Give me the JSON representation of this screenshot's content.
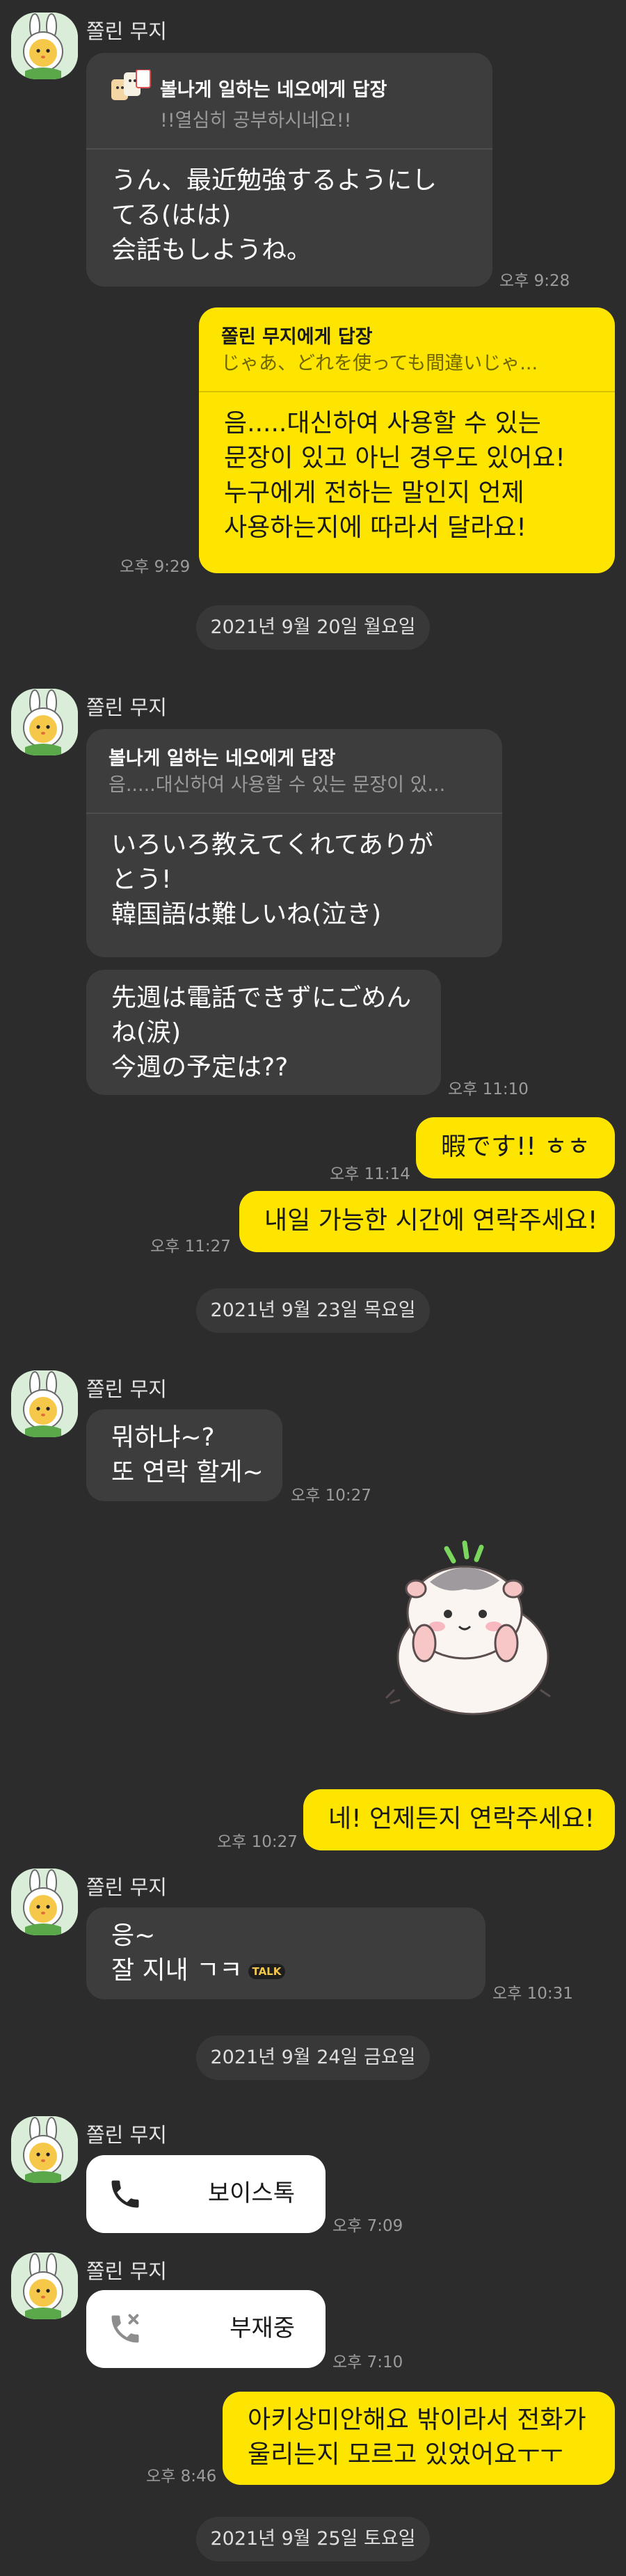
{
  "contact_name": "쫄린 무지",
  "messages": {
    "m1": {
      "reply_to": "볼나게 일하는 네오에게 답장",
      "reply_quote": "!!열심히 공부하시네요!!",
      "lines": [
        "うん、最近勉強するようにし",
        "てる(はは)",
        "会話もしようね。"
      ],
      "time": "오후 9:28"
    },
    "m2": {
      "reply_to": "쫄린 무지에게 답장",
      "reply_quote": "じゃあ、どれを使っても間違いじゃ...",
      "lines": [
        "음.....대신하여 사용할 수 있는",
        "문장이 있고 아닌 경우도 있어요!",
        "누구에게 전하는 말인지 언제",
        "사용하는지에 따라서 달라요!"
      ],
      "time": "오후 9:29"
    },
    "m3": {
      "reply_to": "볼나게 일하는 네오에게 답장",
      "reply_quote": "음.....대신하여 사용할 수 있는 문장이 있...",
      "lines": [
        "いろいろ教えてくれてありが",
        "とう!",
        "韓国語は難しいね(泣き)"
      ]
    },
    "m4": {
      "lines": [
        "先週は電話できずにごめん",
        "ね(涙)",
        "今週の予定は??"
      ],
      "time": "오후 11:10"
    },
    "m5": {
      "text": "暇です!! ㅎㅎ",
      "time": "오후 11:14"
    },
    "m6": {
      "text": "내일 가능한 시간에 연락주세요!",
      "time": "오후 11:27"
    },
    "m7": {
      "lines": [
        "뭐하냐~?",
        "또 연락 할게~"
      ],
      "time": "오후 10:27"
    },
    "m8": {
      "text": "네! 언제든지 연락주세요!",
      "time": "오후 10:27"
    },
    "m9": {
      "lines": [
        "응~",
        "잘 지내 ㄱㅋ"
      ],
      "badge": "TALK",
      "time": "오후 10:31"
    },
    "m10": {
      "label": "보이스톡",
      "time": "오후 7:09"
    },
    "m11": {
      "label": "부재중",
      "time": "오후 7:10"
    },
    "m12": {
      "lines": [
        "아키상미안해요 밖이라서 전화가",
        "울리는지 모르고 있었어요ㅜㅜ"
      ],
      "time": "오후 8:46"
    }
  },
  "dates": {
    "d1": "2021년 9월 20일 월요일",
    "d2": "2021년 9월 23일 목요일",
    "d3": "2021년 9월 24일 금요일",
    "d4": "2021년 9월 25일 토요일"
  },
  "icons": {
    "avatar": "muzi-character-avatar",
    "call": "phone-icon",
    "missed_call": "missed-call-icon",
    "sticker": "hamster-sticker"
  },
  "colors": {
    "background": "#2c2c2c",
    "incoming_bubble": "#3d3d3d",
    "outgoing_bubble": "#fee500",
    "call_bubble": "#ffffff"
  }
}
